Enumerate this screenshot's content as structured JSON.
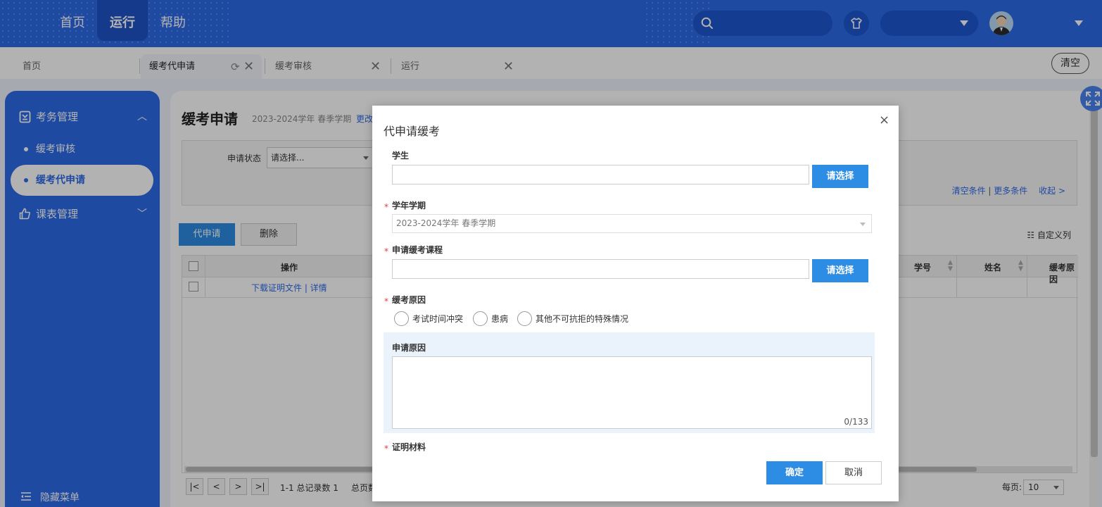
{
  "topnav": {
    "home": "首页",
    "run": "运行",
    "help": "帮助"
  },
  "tabs": {
    "home": "首页",
    "active": "缓考代申请",
    "audit": "缓考审核",
    "run": "运行",
    "clear": "清空"
  },
  "sidebar": {
    "group1": "考务管理",
    "item1": "缓考审核",
    "item2": "缓考代申请",
    "group2": "课表管理",
    "hide": "隐藏菜单"
  },
  "main": {
    "title": "缓考申请",
    "term": "2023-2024学年 春季学期",
    "change": "更改",
    "filter_label": "申请状态",
    "filter_placeholder": "请选择...",
    "links": {
      "clear": "清空条件",
      "sep": "|",
      "more": "更多条件",
      "collapse": "收起 >"
    },
    "btn_apply": "代申请",
    "btn_delete": "删除",
    "custom_cols": "自定义列",
    "grid": {
      "col_op": "操作",
      "col_id": "学号",
      "col_name": "姓名",
      "col_reason": "缓考原因",
      "row_links": "下载证明文件 | 详情"
    },
    "pager": {
      "first": "|<",
      "prev": "<",
      "next": ">",
      "last": ">|",
      "info": "1-1 总记录数 1",
      "pages": "总页数",
      "perpage_label": "每页:",
      "perpage_value": "10"
    }
  },
  "modal": {
    "title": "代申请缓考",
    "close": "×",
    "student_label": "学生",
    "pick": "请选择",
    "term_label": "学年学期",
    "term_value": "2023-2024学年 春季学期",
    "course_label": "申请缓考课程",
    "reason_label": "缓考原因",
    "reasons": [
      "考试时间冲突",
      "患病",
      "其他不可抗拒的特殊情况"
    ],
    "apply_reason_label": "申请原因",
    "counter": "0/133",
    "proof_label": "证明材料",
    "required_mark": "*",
    "ok": "确定",
    "cancel": "取消"
  }
}
